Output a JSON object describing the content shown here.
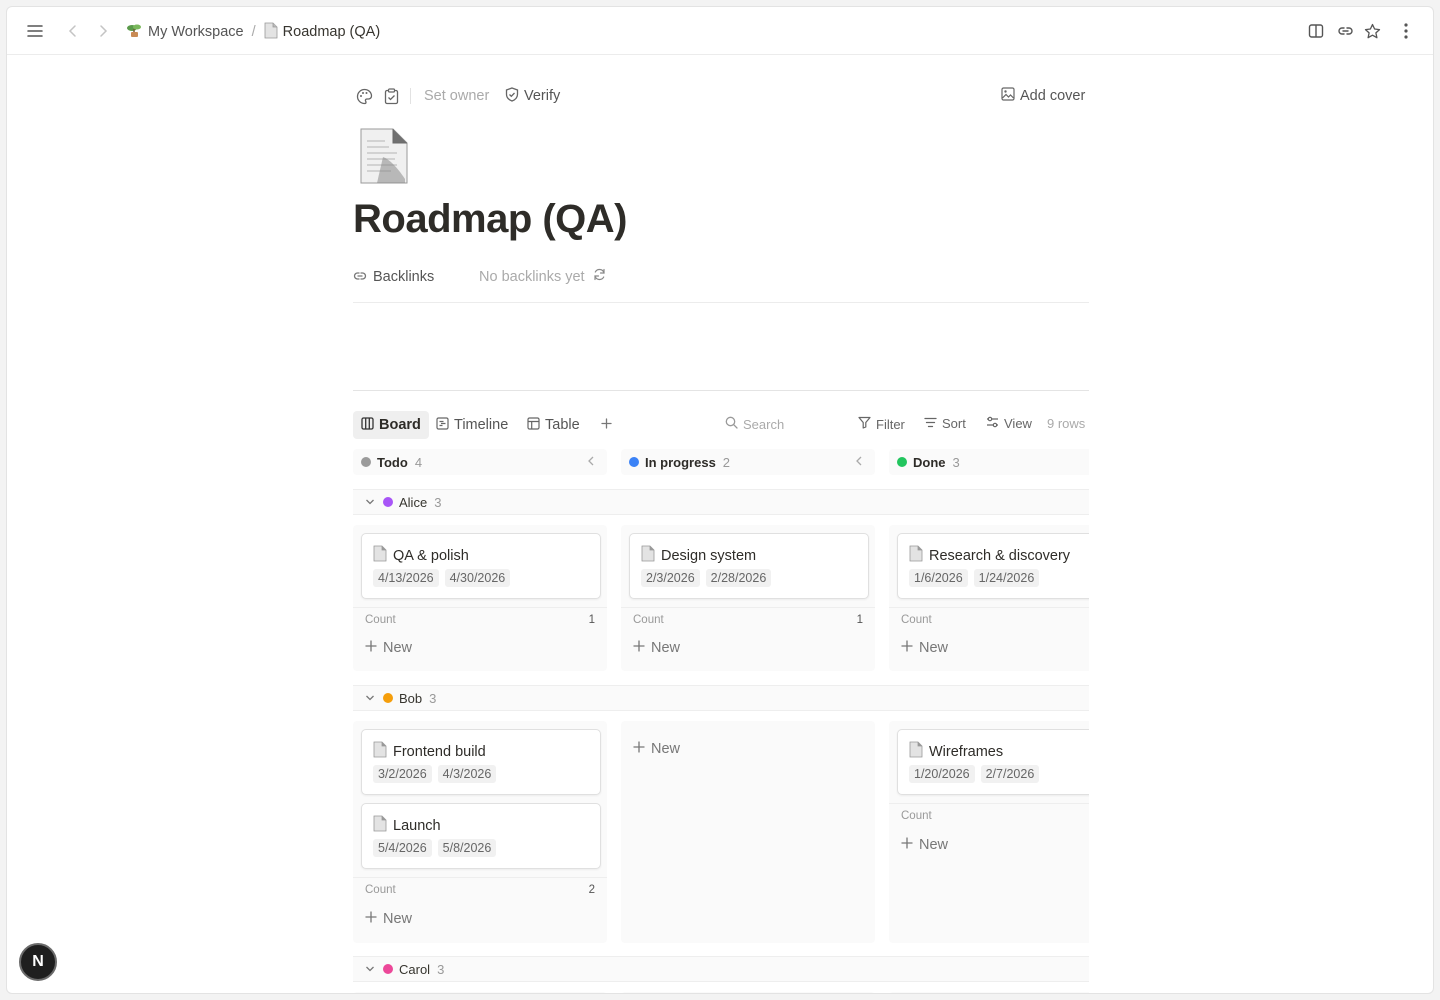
{
  "breadcrumb": {
    "workspace": "My Workspace",
    "separator": "/",
    "page": "Roadmap (QA)"
  },
  "toolbar": {
    "set_owner": "Set owner",
    "verify": "Verify",
    "add_cover": "Add cover"
  },
  "page": {
    "title": "Roadmap (QA)",
    "backlinks_label": "Backlinks",
    "backlinks_empty": "No backlinks yet"
  },
  "views": {
    "tabs": [
      {
        "label": "Board",
        "active": true
      },
      {
        "label": "Timeline",
        "active": false
      },
      {
        "label": "Table",
        "active": false
      }
    ],
    "search_placeholder": "Search",
    "filter": "Filter",
    "sort": "Sort",
    "view": "View",
    "rows": "9 rows"
  },
  "columns": [
    {
      "label": "Todo",
      "count": "4",
      "color": "#9b9b9b"
    },
    {
      "label": "In progress",
      "count": "2",
      "color": "#3b82f6"
    },
    {
      "label": "Done",
      "count": "3",
      "color": "#22c55e"
    }
  ],
  "groups": [
    {
      "label": "Alice",
      "count": "3",
      "color": "#a855f7",
      "lanes": [
        {
          "cards": [
            {
              "title": "QA & polish",
              "start": "4/13/2026",
              "end": "4/30/2026"
            }
          ],
          "count_label": "Count",
          "count": "1",
          "new_label": "New"
        },
        {
          "cards": [
            {
              "title": "Design system",
              "start": "2/3/2026",
              "end": "2/28/2026"
            }
          ],
          "count_label": "Count",
          "count": "1",
          "new_label": "New"
        },
        {
          "cards": [
            {
              "title": "Research & discovery",
              "start": "1/6/2026",
              "end": "1/24/2026"
            }
          ],
          "count_label": "Count",
          "count": "",
          "new_label": "New"
        }
      ]
    },
    {
      "label": "Bob",
      "count": "3",
      "color": "#f59e0b",
      "lanes": [
        {
          "cards": [
            {
              "title": "Frontend build",
              "start": "3/2/2026",
              "end": "4/3/2026"
            },
            {
              "title": "Launch",
              "start": "5/4/2026",
              "end": "5/8/2026"
            }
          ],
          "count_label": "Count",
          "count": "2",
          "new_label": "New"
        },
        {
          "cards": [],
          "new_label": "New"
        },
        {
          "cards": [
            {
              "title": "Wireframes",
              "start": "1/20/2026",
              "end": "2/7/2026"
            }
          ],
          "count_label": "Count",
          "count": "",
          "new_label": "New"
        }
      ]
    },
    {
      "label": "Carol",
      "count": "3",
      "color": "#ec4899"
    }
  ],
  "badge": "N"
}
